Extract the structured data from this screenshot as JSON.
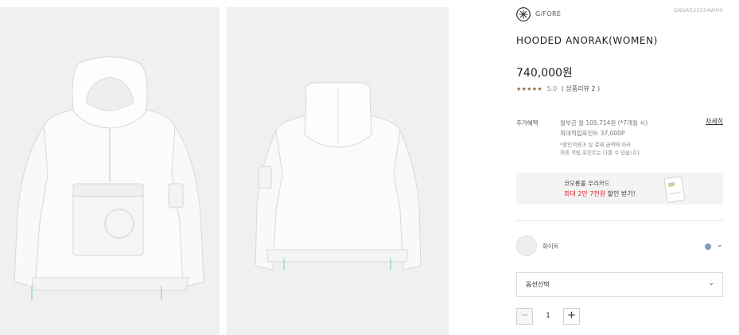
{
  "product": {
    "brand": "G/FORE",
    "code": "GNUA523254WHX",
    "title": "HOODED ANORAK(WOMEN)",
    "price": "740,000원"
  },
  "rating": {
    "stars": "★★★★★",
    "score": "5.0",
    "review_link": "( 상품리뷰 2 )",
    "value": 5.0
  },
  "benefits": {
    "label": "추가혜택",
    "installment": "월부금 월 105,714원 (*7개월 시)",
    "max_points": "최대적립포인트 37,000P",
    "note_line1": "*할인적용과 실 결제 금액에 따라",
    "note_line2": "최종 적립 포인트는 다를 수 있습니다",
    "detail_link": "자세히"
  },
  "card_promo": {
    "line1": "코오롱몰 우리카드",
    "line2_red": "최대 2만 7천원",
    "line2_rest": " 할인 받기!"
  },
  "color_option": {
    "name": "화이트",
    "dot_color": "#7c9ec0",
    "chevron": "⌄"
  },
  "option_select": {
    "label": "옵션선택",
    "chevron": "⌄"
  },
  "quantity": {
    "minus": "−",
    "value": "1",
    "plus": "+"
  },
  "colors": {
    "accent_red": "#d9262c",
    "star_color": "#8a6a3c"
  }
}
